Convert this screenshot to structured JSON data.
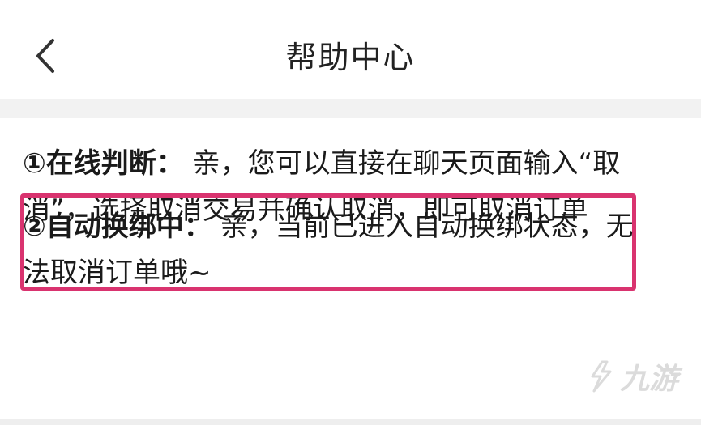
{
  "header": {
    "title": "帮助中心",
    "back_icon": "chevron-left-icon"
  },
  "items": [
    {
      "label": "①在线判断：",
      "text": " 亲，您可以直接在聊天页面输入“取消”，选择取消交易并确认取消，即可取消订单"
    },
    {
      "label": "②自动换绑中：",
      "text": " 亲，当前已进入自动换绑状态，无法取消订单哦~"
    }
  ],
  "watermark": {
    "text": "九游",
    "icon": "jiuyou-logo-icon"
  },
  "colors": {
    "highlight_border": "#d9336f",
    "section_gap": "#f2f2f2",
    "text": "#1a1a1a"
  }
}
